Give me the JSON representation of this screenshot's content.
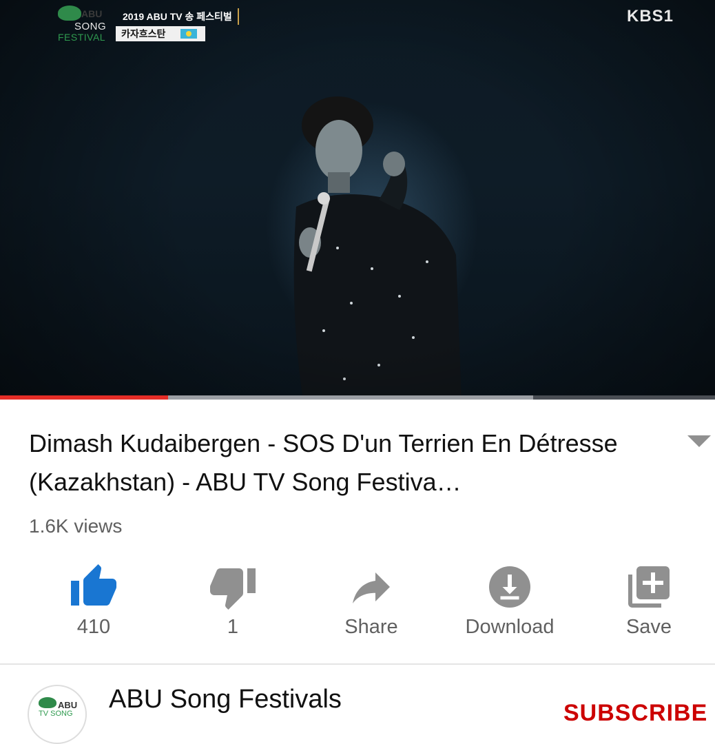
{
  "player": {
    "overlay_logo": {
      "abu": "ABU",
      "song": "SONG",
      "festival": "FESTIVAL"
    },
    "overlay_caption_top": "2019 ABU TV 송 페스티벌",
    "overlay_caption_bottom": "카자흐스탄",
    "broadcaster": "KBS1",
    "progress": {
      "played_fraction": 0.235,
      "buffered_fraction": 0.746
    },
    "colors": {
      "played": "#e52d27",
      "buffered": "#9c9fa4",
      "track": "#4a4e54"
    }
  },
  "video": {
    "title": "Dimash Kudaibergen - SOS D'un Terrien En Détresse (Kazakhstan) - ABU TV Song Festiva…",
    "views": "1.6K views"
  },
  "actions": [
    {
      "id": "like",
      "icon": "thumbs-up-icon",
      "label": "410",
      "color": "#1976d2"
    },
    {
      "id": "dislike",
      "icon": "thumbs-down-icon",
      "label": "1",
      "color": "#909090"
    },
    {
      "id": "share",
      "icon": "share-arrow-icon",
      "label": "Share",
      "color": "#909090"
    },
    {
      "id": "download",
      "icon": "download-icon",
      "label": "Download",
      "color": "#909090"
    },
    {
      "id": "save",
      "icon": "playlist-add-icon",
      "label": "Save",
      "color": "#909090"
    }
  ],
  "channel": {
    "name": "ABU Song Festivals",
    "avatar": {
      "abu": "ABU",
      "tvsong": "TV SONG"
    },
    "subscribe_label": "SUBSCRIBE",
    "subscribe_color": "#cc0000"
  }
}
